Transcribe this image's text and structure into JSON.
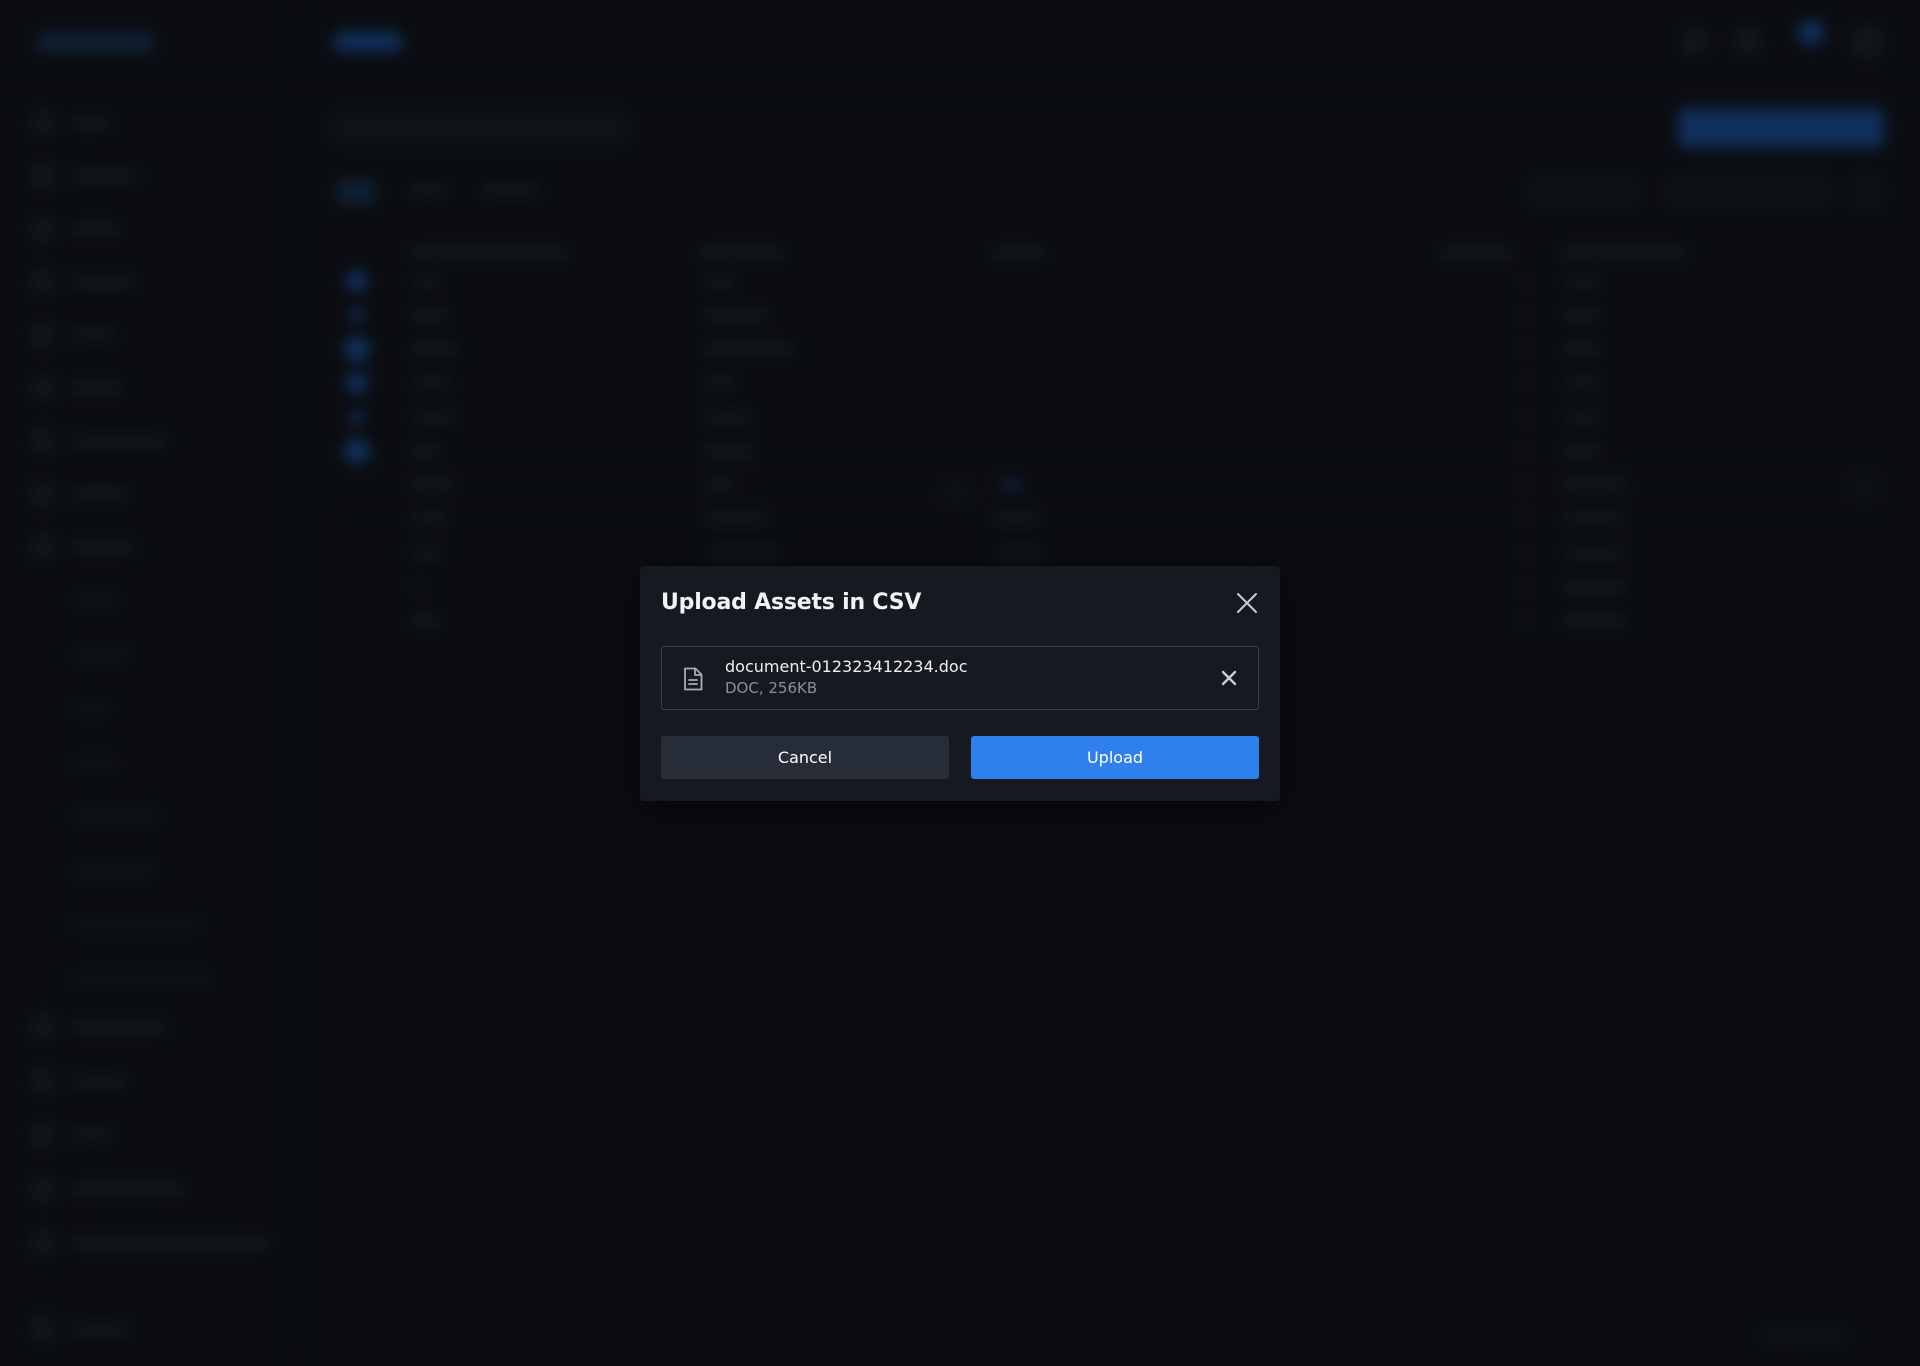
{
  "modal": {
    "title": "Upload Assets in CSV",
    "file": {
      "name": "document-012323412234.doc",
      "meta": "DOC, 256KB"
    },
    "cancel_label": "Cancel",
    "upload_label": "Upload"
  },
  "icons": {
    "close": "close-icon",
    "file": "document-icon",
    "remove": "remove-file-icon"
  },
  "colors": {
    "accent": "#2f80ed",
    "modal_bg": "#161920",
    "secondary_button": "#272d38"
  }
}
